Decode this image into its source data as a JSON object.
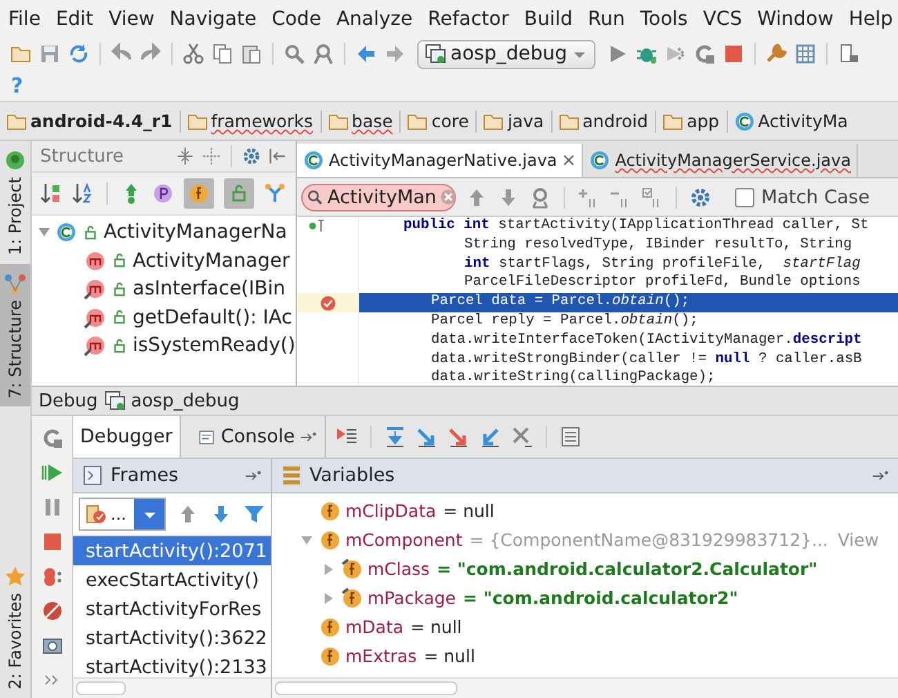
{
  "menu": [
    "File",
    "Edit",
    "View",
    "Navigate",
    "Code",
    "Analyze",
    "Refactor",
    "Build",
    "Run",
    "Tools",
    "VCS",
    "Window",
    "Help"
  ],
  "toolbar": {
    "run_config": "aosp_debug",
    "help": "?"
  },
  "breadcrumbs": [
    {
      "label": "android-4.4_r1",
      "kind": "project"
    },
    {
      "label": "frameworks",
      "kind": "folder"
    },
    {
      "label": "base",
      "kind": "folder"
    },
    {
      "label": "core",
      "kind": "folder"
    },
    {
      "label": "java",
      "kind": "source"
    },
    {
      "label": "android",
      "kind": "package"
    },
    {
      "label": "app",
      "kind": "package"
    },
    {
      "label": "ActivityMa",
      "kind": "class"
    }
  ],
  "side_tabs": [
    {
      "label": "1: Project",
      "selected": false,
      "kind": "project"
    },
    {
      "label": "7: Structure",
      "selected": true,
      "kind": "structure"
    },
    {
      "label": "2: Favorites",
      "selected": false,
      "kind": "favorites"
    }
  ],
  "structure": {
    "title": "Structure",
    "tree": {
      "label": "ActivityManagerNa",
      "expanded": true,
      "children": [
        {
          "label": "ActivityManager",
          "kind": "constructor"
        },
        {
          "label": "asInterface(IBin",
          "kind": "method"
        },
        {
          "label": "getDefault(): IAc",
          "kind": "method"
        },
        {
          "label": "isSystemReady()",
          "kind": "method"
        }
      ]
    }
  },
  "editor": {
    "tabs": [
      {
        "label": "ActivityManagerNative.java",
        "selected": true,
        "close": "×"
      },
      {
        "label": "ActivityManagerService.java",
        "selected": false
      }
    ],
    "search": {
      "value": "ActivityMan",
      "match_case": {
        "label": "Match Case",
        "checked": false
      }
    },
    "lines": [
      {
        "kind": "signature",
        "current": false,
        "breakpoint": false,
        "text": "**public int** startActivity(IApplicationThread caller, St"
      },
      {
        "kind": "continuation",
        "current": false,
        "breakpoint": false,
        "text": "String resolvedType, IBinder resultTo, String"
      },
      {
        "kind": "continuation",
        "current": false,
        "breakpoint": false,
        "text": "**int** startFlags, String profileFile,  *startFlag*"
      },
      {
        "kind": "continuation",
        "current": false,
        "breakpoint": false,
        "text": "ParcelFileDescriptor profileFd, Bundle options"
      },
      {
        "kind": "body",
        "current": true,
        "breakpoint": true,
        "text": "Parcel data = Parcel.*obtain*();"
      },
      {
        "kind": "body",
        "current": false,
        "breakpoint": false,
        "text": "Parcel reply = Parcel.*obtain*();"
      },
      {
        "kind": "body",
        "current": false,
        "breakpoint": false,
        "text": "data.writeInterfaceToken(IActivityManager.**descript**"
      },
      {
        "kind": "body",
        "current": false,
        "breakpoint": false,
        "text": "data.writeStrongBinder(caller != **null** ? caller.asB"
      },
      {
        "kind": "body",
        "current": false,
        "breakpoint": false,
        "text": "data.writeString(callingPackage);"
      }
    ]
  },
  "debug": {
    "title": "Debug",
    "config": "aosp_debug",
    "tabs": [
      {
        "label": "Debugger",
        "selected": true
      },
      {
        "label": "Console",
        "selected": false
      }
    ],
    "frames": {
      "title": "Frames",
      "thread": "...",
      "items": [
        {
          "label": "startActivity():2071",
          "selected": true
        },
        {
          "label": "execStartActivity()",
          "selected": false
        },
        {
          "label": "startActivityForRes",
          "selected": false
        },
        {
          "label": "startActivity():3622",
          "selected": false
        },
        {
          "label": "startActivity():2133",
          "selected": false
        }
      ]
    },
    "variables": {
      "title": "Variables",
      "items": [
        {
          "name": "mClipData",
          "value": "= null",
          "kind": "null",
          "final": false
        },
        {
          "name": "mComponent",
          "value": "= {ComponentName@831929983712}...",
          "link": "View",
          "kind": "object",
          "final": false,
          "expanded": true,
          "children": [
            {
              "name": "mClass",
              "value": "= \"com.android.calculator2.Calculator\"",
              "kind": "string",
              "final": true,
              "expanded": false
            },
            {
              "name": "mPackage",
              "value": "= \"com.android.calculator2\"",
              "kind": "string",
              "final": true,
              "expanded": false
            }
          ]
        },
        {
          "name": "mData",
          "value": "= null",
          "kind": "null",
          "final": false
        },
        {
          "name": "mExtras",
          "value": "= null",
          "kind": "null",
          "final": false
        }
      ]
    }
  }
}
